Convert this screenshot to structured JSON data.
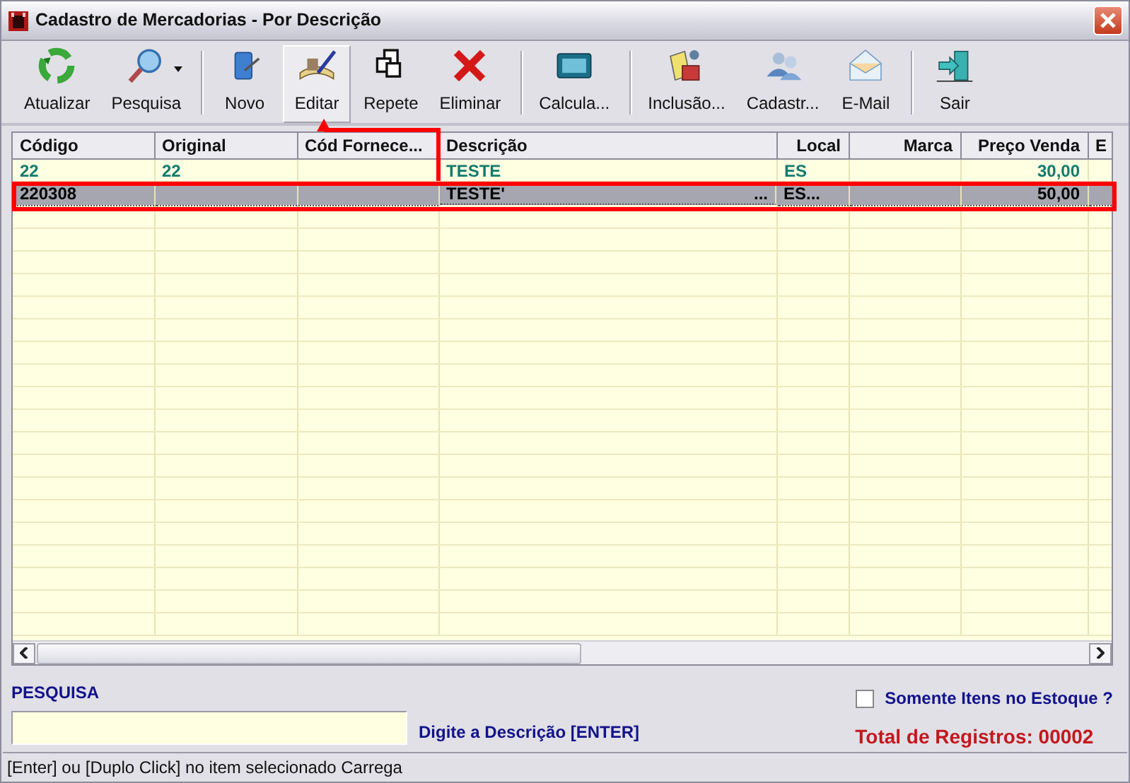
{
  "window": {
    "title": "Cadastro de Mercadorias - Por Descrição"
  },
  "toolbar": [
    {
      "kind": "button",
      "label": "Atualizar",
      "selected": false
    },
    {
      "kind": "button",
      "label": "Pesquisa",
      "selected": false,
      "dropdown": true
    },
    {
      "kind": "separator"
    },
    {
      "kind": "button",
      "label": "Novo",
      "selected": false
    },
    {
      "kind": "button",
      "label": "Editar",
      "selected": true
    },
    {
      "kind": "button",
      "label": "Repete",
      "selected": false
    },
    {
      "kind": "button",
      "label": "Eliminar",
      "selected": false
    },
    {
      "kind": "separator"
    },
    {
      "kind": "button",
      "label": "Calcula...",
      "selected": false
    },
    {
      "kind": "separator"
    },
    {
      "kind": "button",
      "label": "Inclusão...",
      "selected": false
    },
    {
      "kind": "button",
      "label": "Cadastr...",
      "selected": false
    },
    {
      "kind": "button",
      "label": "E-Mail",
      "selected": false
    },
    {
      "kind": "separator"
    },
    {
      "kind": "button",
      "label": "Sair",
      "selected": false
    }
  ],
  "table": {
    "columns": [
      "Código",
      "Original",
      "Cód Fornece...",
      "Descrição",
      "Local",
      "Marca",
      "Preço Venda",
      "E"
    ],
    "rows": [
      {
        "selected": false,
        "cells": [
          "22",
          "22",
          "",
          "TESTE",
          "ES",
          "",
          "30,00",
          ""
        ]
      },
      {
        "selected": true,
        "cells": [
          "220308",
          "",
          "",
          "TESTE'",
          "ES...",
          "",
          "50,00",
          ""
        ],
        "description_more": "..."
      }
    ]
  },
  "search": {
    "label": "PESQUISA",
    "hint": "Digite a Descrição [ENTER]",
    "stock_only": {
      "label": "Somente Itens no Estoque ?",
      "checked": false
    },
    "total": "Total de Registros: 00002"
  },
  "status_bar": "[Enter] ou [Duplo Click] no item selecionado Carrega"
}
